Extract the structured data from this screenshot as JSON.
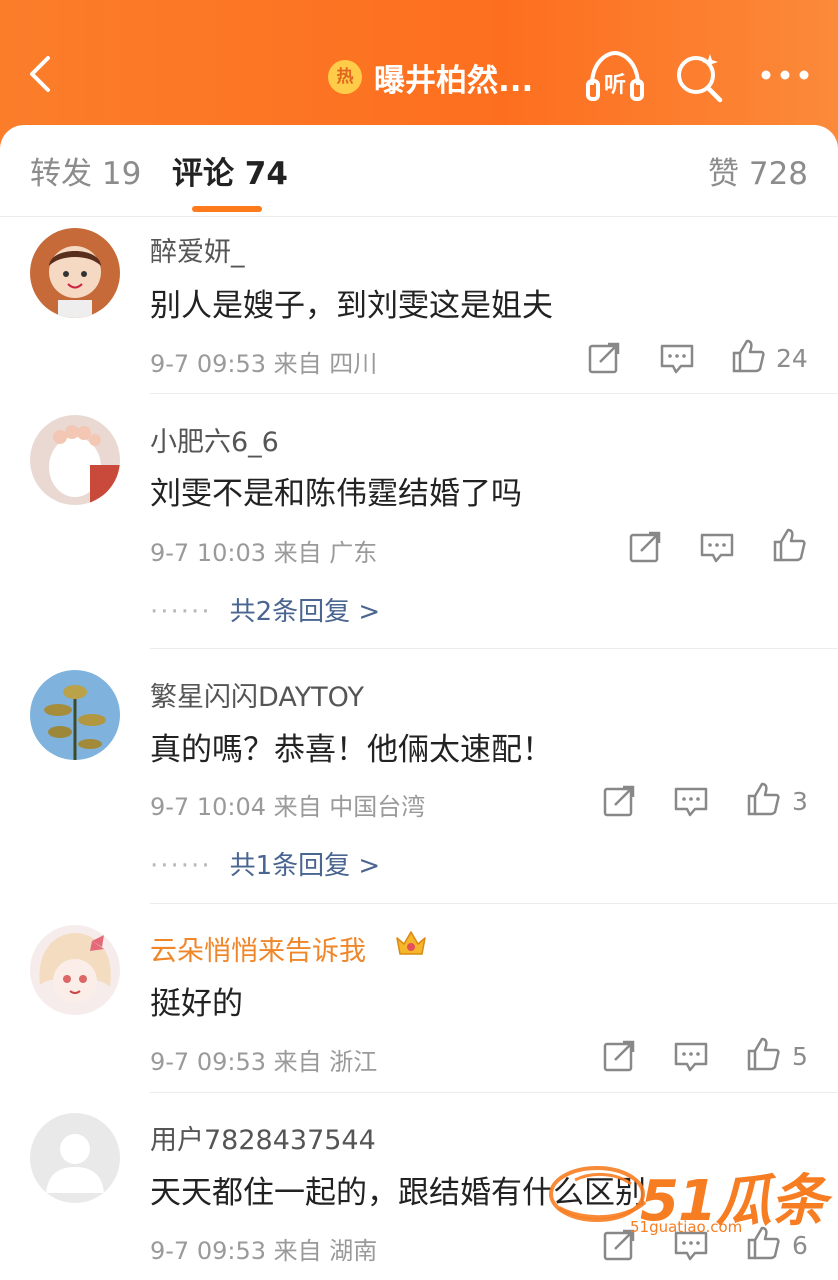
{
  "header": {
    "back_icon": "chevron-left-icon",
    "badge_text": "热",
    "title": "曝井柏然...",
    "listen_label": "听"
  },
  "tabs": {
    "repost": "转发 19",
    "comment": "评论 74",
    "like": "赞 728"
  },
  "comments": [
    {
      "user": "醉爱妍_",
      "text": "别人是嫂子，到刘雯这是姐夫",
      "time": "9-7 09:53 来自 四川",
      "likes": "24",
      "replies": ""
    },
    {
      "user": "小肥六6_6",
      "text": "刘雯不是和陈伟霆结婚了吗",
      "time": "9-7 10:03 来自 广东",
      "likes": "",
      "replies": "共2条回复 >"
    },
    {
      "user": "繁星闪闪DAYTOY",
      "text": "真的嗎？恭喜！他倆太速配！",
      "time": "9-7 10:04 来自 中国台湾",
      "likes": "3",
      "replies": "共1条回复 >"
    },
    {
      "user": "云朵悄悄来告诉我",
      "text": "挺好的",
      "time": "9-7 09:53 来自 浙江",
      "likes": "5",
      "replies": "",
      "vip": true
    },
    {
      "user": "用户7828437544",
      "text": "天天都住一起的，跟结婚有什么区别",
      "time": "9-7 09:53 来自 湖南",
      "likes": "6",
      "replies": ""
    }
  ],
  "reply_dots": "······",
  "watermark": {
    "text": "51瓜条",
    "url": "51guatiao.com"
  },
  "colors": {
    "accent": "#ff7a1a",
    "link": "#4a6590",
    "vip_name": "#f0862a"
  }
}
